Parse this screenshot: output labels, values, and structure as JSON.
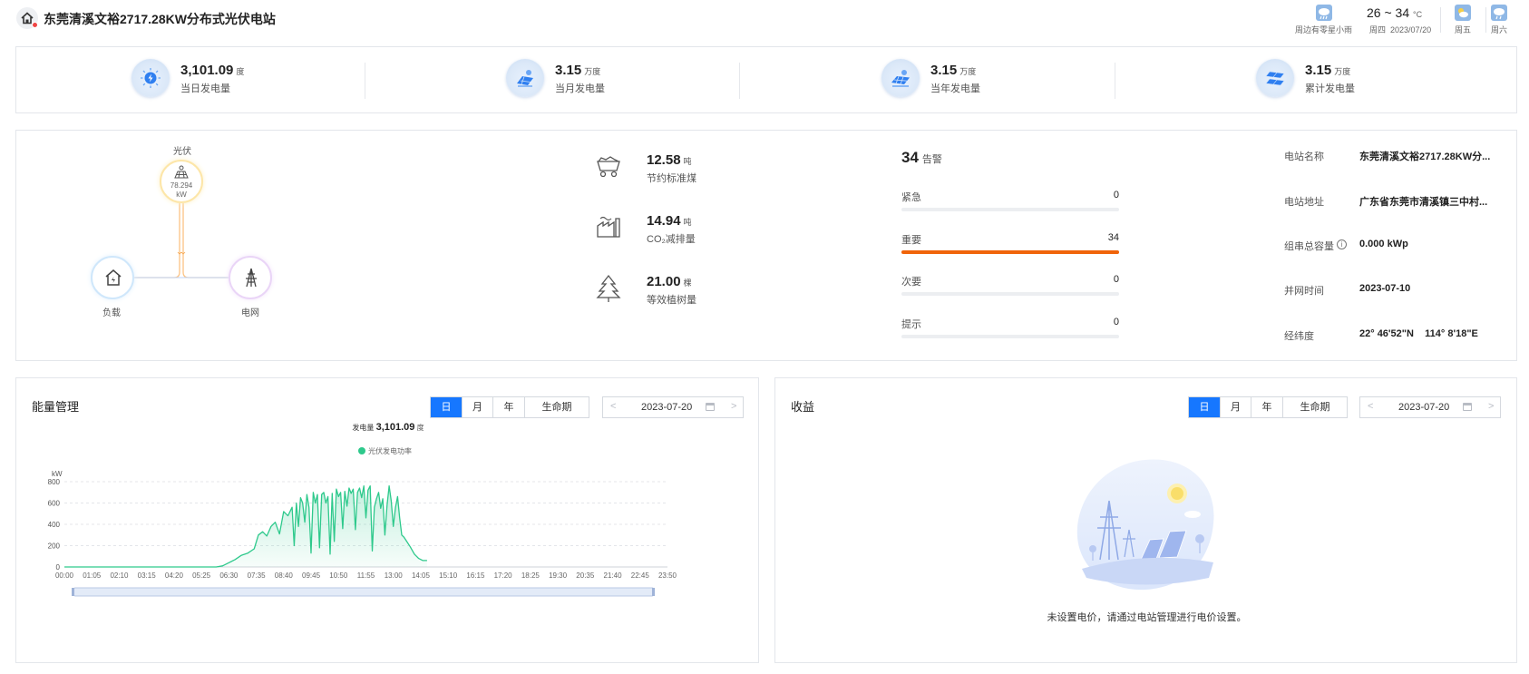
{
  "header": {
    "title": "东莞清溪文裕2717.28KW分布式光伏电站",
    "weather_now_label": "周边有零星小雨",
    "temperature": "26 ~ 34",
    "temperature_unit": "°C",
    "weekday_today": "周四",
    "date_today": "2023/07/20",
    "forecast": [
      {
        "day": "周五",
        "icon": "partly-cloudy-icon"
      },
      {
        "day": "周六",
        "icon": "rain-icon"
      }
    ]
  },
  "stats": [
    {
      "value": "3,101.09",
      "unit": "度",
      "label": "当日发电量",
      "icon": "sun-energy-icon"
    },
    {
      "value": "3.15",
      "unit": "万度",
      "label": "当月发电量",
      "icon": "solar-panel-icon"
    },
    {
      "value": "3.15",
      "unit": "万度",
      "label": "当年发电量",
      "icon": "solar-panel-icon"
    },
    {
      "value": "3.15",
      "unit": "万度",
      "label": "累计发电量",
      "icon": "solar-array-icon"
    }
  ],
  "flow": {
    "pv_label": "光伏",
    "pv_value": "78.294",
    "pv_unit": "kW",
    "load_label": "负载",
    "grid_label": "电网"
  },
  "environment": [
    {
      "value": "12.58",
      "unit": "吨",
      "label": "节约标准煤",
      "icon": "coal-cart-icon"
    },
    {
      "value": "14.94",
      "unit": "吨",
      "label": "CO₂减排量",
      "icon": "factory-icon"
    },
    {
      "value": "21.00",
      "unit": "棵",
      "label": "等效植树量",
      "icon": "tree-icon"
    }
  ],
  "alarms": {
    "total": "34",
    "total_label": "告警",
    "rows": [
      {
        "name": "紧急",
        "count": "0",
        "fraction": 0
      },
      {
        "name": "重要",
        "count": "34",
        "fraction": 1
      },
      {
        "name": "次要",
        "count": "0",
        "fraction": 0
      },
      {
        "name": "提示",
        "count": "0",
        "fraction": 0
      }
    ]
  },
  "station_info": [
    {
      "key": "电站名称",
      "value": "东莞清溪文裕2717.28KW分..."
    },
    {
      "key": "电站地址",
      "value": "广东省东莞市清溪镇三中村..."
    },
    {
      "key": "组串总容量",
      "value": "0.000 kWp"
    },
    {
      "key": "并网时间",
      "value": "2023-07-10"
    },
    {
      "key": "经纬度",
      "value": "22° 46'52\"N    114° 8'18\"E"
    }
  ],
  "energy": {
    "title": "能量管理",
    "tabs": [
      "日",
      "月",
      "年",
      "生命期"
    ],
    "active_tab": "日",
    "date": "2023-07-20",
    "summary_label": "发电量",
    "summary_value": "3,101.09",
    "summary_unit": "度"
  },
  "income": {
    "title": "收益",
    "tabs": [
      "日",
      "月",
      "年",
      "生命期"
    ],
    "active_tab": "日",
    "date": "2023-07-20",
    "empty_text": "未设置电价，请通过电站管理进行电价设置。"
  },
  "chart_data": {
    "type": "area",
    "ylabel": "kW",
    "ylim": [
      0,
      800
    ],
    "yticks": [
      0,
      200,
      400,
      600,
      800
    ],
    "xlim_minutes": [
      0,
      1430
    ],
    "xticks": [
      "00:00",
      "01:05",
      "02:10",
      "03:15",
      "04:20",
      "05:25",
      "06:30",
      "07:35",
      "08:40",
      "09:45",
      "10:50",
      "11:55",
      "13:00",
      "14:05",
      "15:10",
      "16:15",
      "17:20",
      "18:25",
      "19:30",
      "20:35",
      "21:40",
      "22:45",
      "23:50"
    ],
    "grid": true,
    "legend": "top-center",
    "color": "#2ec98c",
    "series": [
      {
        "name": "光伏发电功率",
        "x": [
          "00:00",
          "06:00",
          "06:15",
          "06:30",
          "06:45",
          "07:00",
          "07:15",
          "07:30",
          "07:40",
          "07:50",
          "08:00",
          "08:10",
          "08:20",
          "08:30",
          "08:40",
          "08:50",
          "09:00",
          "09:05",
          "09:10",
          "09:15",
          "09:20",
          "09:25",
          "09:30",
          "09:35",
          "09:40",
          "09:45",
          "09:50",
          "09:55",
          "10:00",
          "10:05",
          "10:10",
          "10:15",
          "10:20",
          "10:25",
          "10:30",
          "10:35",
          "10:40",
          "10:45",
          "10:50",
          "10:55",
          "11:00",
          "11:05",
          "11:10",
          "11:15",
          "11:20",
          "11:25",
          "11:30",
          "11:35",
          "11:40",
          "11:45",
          "11:50",
          "11:55",
          "12:00",
          "12:05",
          "12:10",
          "12:15",
          "12:20",
          "12:25",
          "12:30",
          "12:35",
          "12:40",
          "12:45",
          "12:50",
          "12:55",
          "13:00",
          "13:05",
          "13:10",
          "13:15",
          "13:20",
          "13:25",
          "13:30",
          "13:40",
          "13:50",
          "14:00",
          "14:10",
          "14:20"
        ],
        "y": [
          0,
          0,
          10,
          40,
          70,
          110,
          130,
          170,
          300,
          330,
          290,
          380,
          420,
          310,
          520,
          480,
          560,
          200,
          600,
          380,
          650,
          600,
          420,
          680,
          560,
          130,
          700,
          600,
          680,
          180,
          680,
          700,
          600,
          660,
          120,
          690,
          240,
          730,
          660,
          700,
          360,
          710,
          570,
          740,
          690,
          730,
          350,
          700,
          740,
          650,
          760,
          460,
          720,
          760,
          150,
          560,
          640,
          700,
          550,
          640,
          300,
          580,
          760,
          620,
          380,
          560,
          660,
          460,
          300,
          280,
          250,
          190,
          120,
          80,
          60,
          60
        ]
      }
    ]
  }
}
